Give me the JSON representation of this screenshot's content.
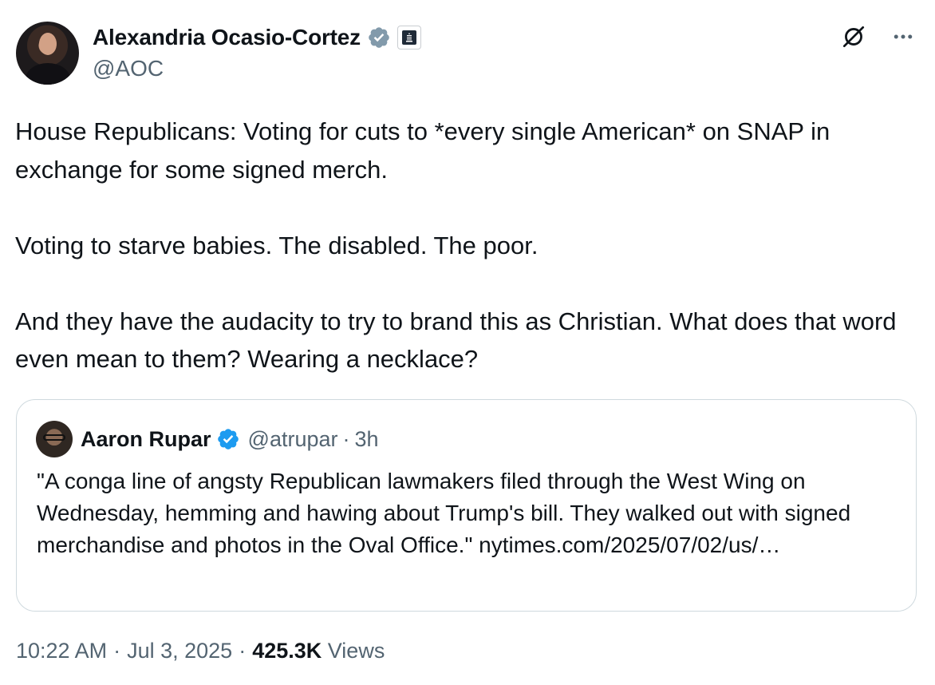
{
  "author": {
    "name": "Alexandria Ocasio-Cortez",
    "handle": "@AOC"
  },
  "tweet": {
    "text": "House Republicans: Voting for cuts to *every single American* on SNAP in exchange for some signed merch.\n\nVoting to starve babies. The disabled. The poor.\n\nAnd they have the audacity to try to brand this as Christian. What does that word even mean to them? Wearing a necklace?"
  },
  "quote": {
    "name": "Aaron Rupar",
    "handle": "@atrupar",
    "separator": "·",
    "time": "3h",
    "text": "\"A conga line of angsty Republican lawmakers filed through the West Wing on Wednesday, hemming and hawing about Trump's bill. They walked out with signed merchandise and photos in the Oval Office.\" nytimes.com/2025/07/02/us/…"
  },
  "meta": {
    "time": "10:22 AM",
    "sep1": "·",
    "date": "Jul 3, 2025",
    "sep2": "·",
    "views_count": "425.3K",
    "views_label": "Views"
  },
  "icons": {
    "verified": "verified-badge-icon",
    "government": "government-badge-icon",
    "grok": "grok-icon",
    "more": "more-icon"
  },
  "colors": {
    "verified_gray": "#829aab",
    "verified_blue": "#1d9bf0",
    "text": "#0f1419",
    "secondary": "#536471",
    "border": "#cfd9de"
  }
}
